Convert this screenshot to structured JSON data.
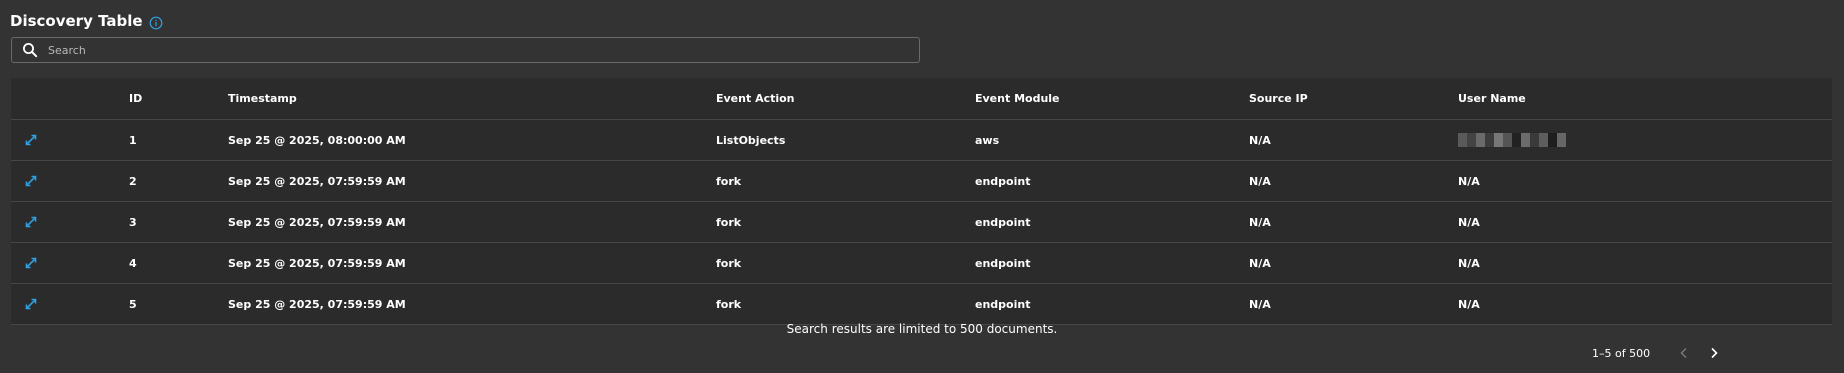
{
  "header": {
    "title": "Discovery Table"
  },
  "search": {
    "placeholder": "Search",
    "value": ""
  },
  "table": {
    "columns": [
      "",
      "ID",
      "Timestamp",
      "Event Action",
      "Event Module",
      "Source IP",
      "User Name"
    ],
    "rows": [
      {
        "id": "1",
        "timestamp": "Sep 25 @ 2025, 08:00:00 AM",
        "event_action": "ListObjects",
        "event_module": "aws",
        "source_ip": "N/A",
        "user_name": "[redacted]"
      },
      {
        "id": "2",
        "timestamp": "Sep 25 @ 2025, 07:59:59 AM",
        "event_action": "fork",
        "event_module": "endpoint",
        "source_ip": "N/A",
        "user_name": "N/A"
      },
      {
        "id": "3",
        "timestamp": "Sep 25 @ 2025, 07:59:59 AM",
        "event_action": "fork",
        "event_module": "endpoint",
        "source_ip": "N/A",
        "user_name": "N/A"
      },
      {
        "id": "4",
        "timestamp": "Sep 25 @ 2025, 07:59:59 AM",
        "event_action": "fork",
        "event_module": "endpoint",
        "source_ip": "N/A",
        "user_name": "N/A"
      },
      {
        "id": "5",
        "timestamp": "Sep 25 @ 2025, 07:59:59 AM",
        "event_action": "fork",
        "event_module": "endpoint",
        "source_ip": "N/A",
        "user_name": "N/A"
      }
    ]
  },
  "footer": {
    "limit_message": "Search results are limited to 500 documents.",
    "range": "1–5 of 500"
  },
  "icons": {
    "info": "info-icon",
    "search": "search-icon",
    "expand": "expand-icon",
    "prev": "chevron-left-icon",
    "next": "chevron-right-icon"
  },
  "colors": {
    "background": "#333333",
    "table_background": "#2b2b2b",
    "accent": "#2f9fe0",
    "border": "#474747",
    "disabled": "#7a7a7a"
  }
}
